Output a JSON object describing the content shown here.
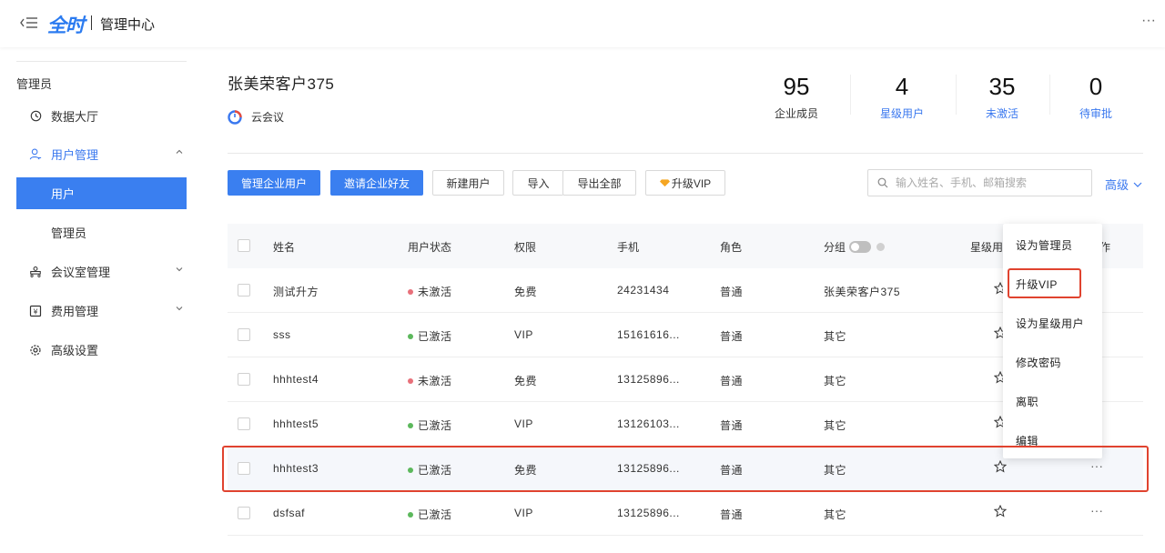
{
  "header": {
    "brand": "全时",
    "title": "管理中心",
    "more": "···"
  },
  "sidebar": {
    "section_label": "管理员",
    "items": [
      {
        "label": "数据大厅"
      },
      {
        "label": "用户管理"
      },
      {
        "label": "用户"
      },
      {
        "label": "管理员"
      },
      {
        "label": "会议室管理"
      },
      {
        "label": "费用管理"
      },
      {
        "label": "高级设置"
      }
    ]
  },
  "company": {
    "name": "张美荣客户375",
    "product": "云会议"
  },
  "stats": [
    {
      "value": "95",
      "label": "企业成员"
    },
    {
      "value": "4",
      "label": "星级用户"
    },
    {
      "value": "35",
      "label": "未激活"
    },
    {
      "value": "0",
      "label": "待审批"
    }
  ],
  "toolbar": {
    "manage_users": "管理企业用户",
    "invite_friends": "邀请企业好友",
    "new_user": "新建用户",
    "import": "导入",
    "export_all": "导出全部",
    "upgrade_vip": "升级VIP",
    "search_placeholder": "输入姓名、手机、邮箱搜索",
    "advanced": "高级"
  },
  "table": {
    "headers": {
      "name": "姓名",
      "status": "用户状态",
      "permission": "权限",
      "phone": "手机",
      "role": "角色",
      "group": "分组",
      "star": "星级用",
      "action": "作"
    },
    "rows": [
      {
        "name": "测试升方",
        "status": "未激活",
        "permission": "免费",
        "phone": "24231434",
        "role": "普通",
        "group": "张美荣客户375"
      },
      {
        "name": "sss",
        "status": "已激活",
        "permission": "VIP",
        "phone": "15161616...",
        "role": "普通",
        "group": "其它"
      },
      {
        "name": "hhhtest4",
        "status": "未激活",
        "permission": "免费",
        "phone": "13125896...",
        "role": "普通",
        "group": "其它"
      },
      {
        "name": "hhhtest5",
        "status": "已激活",
        "permission": "VIP",
        "phone": "13126103...",
        "role": "普通",
        "group": "其它"
      },
      {
        "name": "hhhtest3",
        "status": "已激活",
        "permission": "免费",
        "phone": "13125896...",
        "role": "普通",
        "group": "其它"
      },
      {
        "name": "dsfsaf",
        "status": "已激活",
        "permission": "VIP",
        "phone": "13125896...",
        "role": "普通",
        "group": "其它"
      }
    ],
    "row_more": "···"
  },
  "dropdown": {
    "items": [
      "设为管理员",
      "升级VIP",
      "设为星级用户",
      "修改密码",
      "离职",
      "编辑"
    ]
  },
  "colors": {
    "accent": "#3a7ff0",
    "inactive": "#e8707a",
    "active": "#5cb85c",
    "highlight": "#e0432f"
  }
}
